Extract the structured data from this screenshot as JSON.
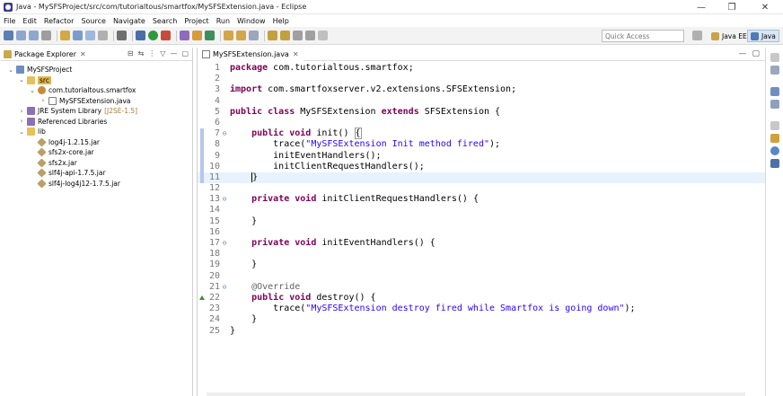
{
  "window": {
    "title": "Java - MySFSProject/src/com/tutorialtous/smartfox/MySFSExtension.java - Eclipse",
    "controls": [
      "—",
      "❐",
      "✕"
    ]
  },
  "menu": [
    "File",
    "Edit",
    "Refactor",
    "Source",
    "Navigate",
    "Search",
    "Project",
    "Run",
    "Window",
    "Help"
  ],
  "toolbar": {
    "quick_access_placeholder": "Quick Access",
    "perspectives": [
      "Java EE",
      "Java"
    ],
    "colors": {
      "accent": "#d9e6f5"
    }
  },
  "package_explorer": {
    "tab_label": "Package Explorer",
    "tab_close": "✕",
    "tools": [
      "⊟",
      "⇆",
      "⋮",
      "▽",
      "—",
      "▢"
    ],
    "tree": [
      {
        "label": "MySFSProject",
        "twisty": "⌄",
        "icon": "project-icon"
      },
      {
        "label": "src",
        "twisty": "⌄",
        "icon": "folder-icon"
      },
      {
        "label": "com.tutorialtous.smartfox",
        "twisty": "⌄",
        "icon": "package-icon"
      },
      {
        "label": "MySFSExtension.java",
        "twisty": "›",
        "icon": "java-file-icon"
      },
      {
        "label": "JRE System Library",
        "suffix": "[J2SE-1.5]",
        "twisty": "›",
        "icon": "library-icon"
      },
      {
        "label": "Referenced Libraries",
        "twisty": "›",
        "icon": "library-icon"
      },
      {
        "label": "lib",
        "twisty": "⌄",
        "icon": "folder-icon"
      },
      {
        "label": "log4j-1.2.15.jar",
        "twisty": "",
        "icon": "jar-icon"
      },
      {
        "label": "sfs2x-core.jar",
        "twisty": "",
        "icon": "jar-icon"
      },
      {
        "label": "sfs2x.jar",
        "twisty": "",
        "icon": "jar-icon"
      },
      {
        "label": "slf4j-api-1.7.5.jar",
        "twisty": "",
        "icon": "jar-icon"
      },
      {
        "label": "slf4j-log4j12-1.7.5.jar",
        "twisty": "",
        "icon": "jar-icon"
      }
    ]
  },
  "editor": {
    "tab_label": "MySFSExtension.java",
    "tab_close": "✕",
    "tools": [
      "—",
      "▢"
    ],
    "lines": [
      {
        "n": "1",
        "fold": "",
        "parts": [
          [
            "kw",
            "package"
          ],
          [
            "",
            "com.tutorialtous.smartfox;"
          ]
        ]
      },
      {
        "n": "2",
        "fold": "",
        "parts": []
      },
      {
        "n": "3",
        "fold": "",
        "parts": [
          [
            "kw",
            "import"
          ],
          [
            "",
            "com.smartfoxserver.v2.extensions.SFSExtension;"
          ]
        ]
      },
      {
        "n": "4",
        "fold": "",
        "parts": []
      },
      {
        "n": "5",
        "fold": "",
        "parts": [
          [
            "kw",
            "public class"
          ],
          [
            "",
            " MySFSExtension "
          ],
          [
            "kw",
            "extends"
          ],
          [
            "",
            " SFSExtension {"
          ]
        ]
      },
      {
        "n": "6",
        "fold": "",
        "parts": []
      },
      {
        "n": "7",
        "fold": "⊖",
        "marker": "bar",
        "parts": [
          [
            "",
            "    "
          ],
          [
            "kw",
            "public void"
          ],
          [
            "",
            " init() "
          ],
          [
            "br",
            "{"
          ]
        ]
      },
      {
        "n": "8",
        "fold": "",
        "marker": "bar",
        "parts": [
          [
            "",
            "        trace("
          ],
          [
            "str",
            "\"MySFSExtension Init method fired\""
          ],
          [
            "",
            ");"
          ]
        ]
      },
      {
        "n": "9",
        "fold": "",
        "marker": "bar",
        "parts": [
          [
            "",
            "        initEventHandlers();"
          ]
        ]
      },
      {
        "n": "10",
        "fold": "",
        "marker": "bar",
        "parts": [
          [
            "",
            "        initClientRequestHandlers();"
          ]
        ]
      },
      {
        "n": "11",
        "fold": "",
        "marker": "bar",
        "current": true,
        "parts": [
          [
            "",
            "    "
          ],
          [
            "cur",
            "}"
          ]
        ]
      },
      {
        "n": "12",
        "fold": "",
        "parts": []
      },
      {
        "n": "13",
        "fold": "⊖",
        "parts": [
          [
            "",
            "    "
          ],
          [
            "kw",
            "private void"
          ],
          [
            "",
            " initClientRequestHandlers() {"
          ]
        ]
      },
      {
        "n": "14",
        "fold": "",
        "parts": []
      },
      {
        "n": "15",
        "fold": "",
        "parts": [
          [
            "",
            "    }"
          ]
        ]
      },
      {
        "n": "16",
        "fold": "",
        "parts": []
      },
      {
        "n": "17",
        "fold": "⊖",
        "parts": [
          [
            "",
            "    "
          ],
          [
            "kw",
            "private void"
          ],
          [
            "",
            " initEventHandlers() {"
          ]
        ]
      },
      {
        "n": "18",
        "fold": "",
        "parts": []
      },
      {
        "n": "19",
        "fold": "",
        "parts": [
          [
            "",
            "    }"
          ]
        ]
      },
      {
        "n": "20",
        "fold": "",
        "parts": []
      },
      {
        "n": "21",
        "fold": "⊖",
        "parts": [
          [
            "",
            "    "
          ],
          [
            "ann",
            "@Override"
          ]
        ]
      },
      {
        "n": "22",
        "fold": "",
        "marker": "override",
        "parts": [
          [
            "",
            "    "
          ],
          [
            "kw",
            "public void"
          ],
          [
            "",
            " destroy() {"
          ]
        ]
      },
      {
        "n": "23",
        "fold": "",
        "parts": [
          [
            "",
            "        trace("
          ],
          [
            "str",
            "\"MySFSExtension destroy fired while Smartfox is going down\""
          ],
          [
            "",
            ");"
          ]
        ]
      },
      {
        "n": "24",
        "fold": "",
        "parts": [
          [
            "",
            "    }"
          ]
        ]
      },
      {
        "n": "25",
        "fold": "",
        "parts": [
          [
            "",
            "}"
          ]
        ]
      }
    ]
  }
}
